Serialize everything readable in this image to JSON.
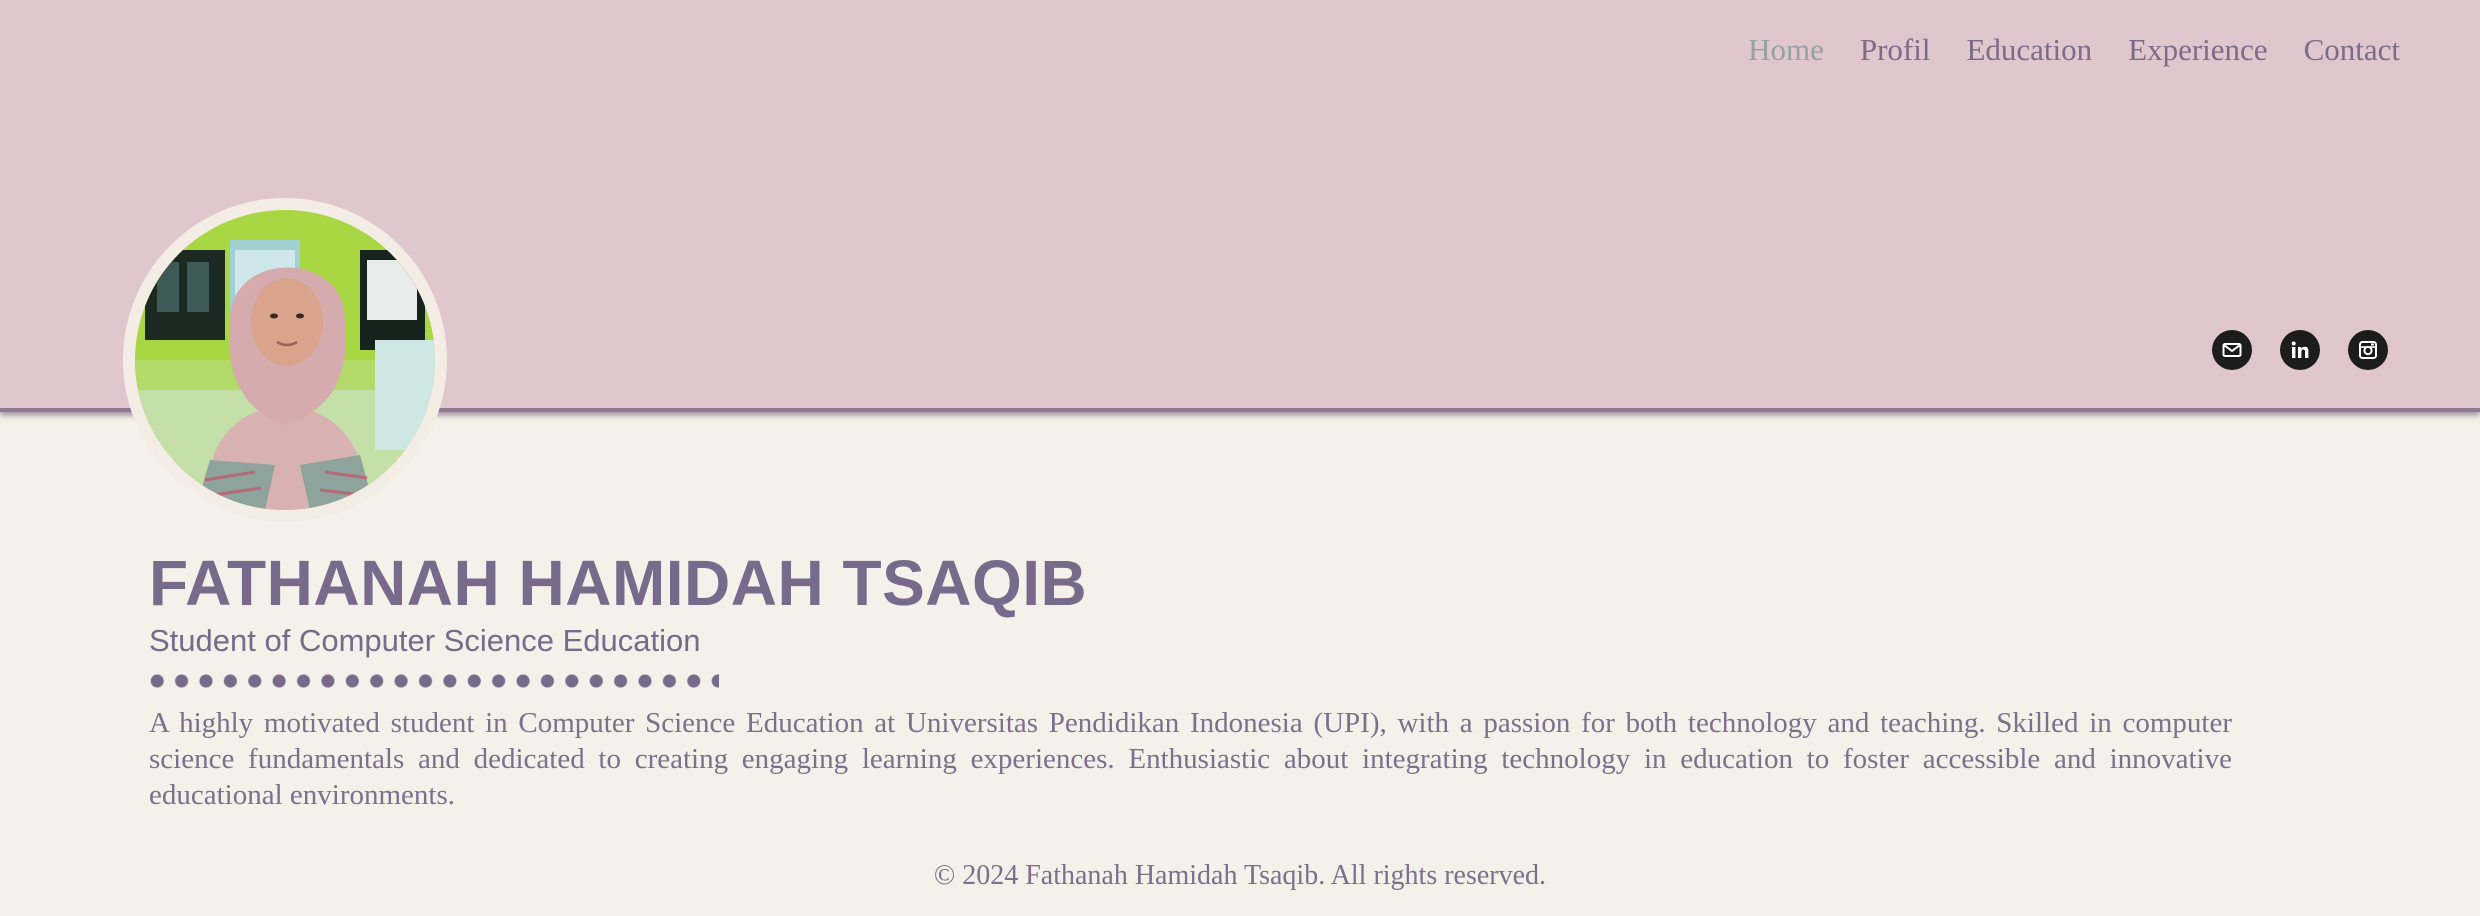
{
  "nav": {
    "items": [
      {
        "label": "Home",
        "active": true
      },
      {
        "label": "Profil"
      },
      {
        "label": "Education"
      },
      {
        "label": "Experience"
      },
      {
        "label": "Contact"
      }
    ]
  },
  "social": {
    "icons": [
      "email-icon",
      "linkedin-icon",
      "instagram-icon"
    ]
  },
  "profile": {
    "name": "FATHANAH HAMIDAH TSAQIB",
    "role": "Student of Computer Science Education",
    "bio": "A highly motivated student in Computer Science Education at Universitas Pendidikan Indonesia (UPI), with a passion for both technology and teaching. Skilled in computer science fundamentals and dedicated to creating engaging learning experiences. Enthusiastic about integrating technology in education to foster accessible and innovative educational environments."
  },
  "footer": {
    "text": "© 2024 Fathanah Hamidah Tsaqib. All rights reserved."
  },
  "colors": {
    "header_bg": "#dfc7cd",
    "page_bg": "#f4f0ea",
    "accent": "#776a8a",
    "nav_active": "#95a1a3"
  }
}
